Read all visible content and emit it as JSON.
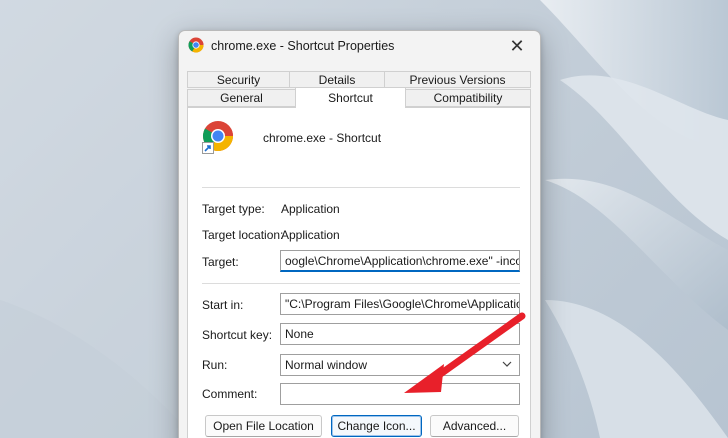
{
  "window": {
    "title": "chrome.exe - Shortcut Properties",
    "close_glyph": "✕"
  },
  "tabs": {
    "row1": [
      "Security",
      "Details",
      "Previous Versions"
    ],
    "row2": [
      "General",
      "Shortcut",
      "Compatibility"
    ],
    "active": "Shortcut"
  },
  "shortcut": {
    "name": "chrome.exe - Shortcut",
    "target_type_label": "Target type:",
    "target_type_value": "Application",
    "target_location_label": "Target location:",
    "target_location_value": "Application",
    "target_label": "Target:",
    "target_value": "oogle\\Chrome\\Application\\chrome.exe\" -incognito",
    "start_in_label": "Start in:",
    "start_in_value": "\"C:\\Program Files\\Google\\Chrome\\Application\"",
    "shortcut_key_label": "Shortcut key:",
    "shortcut_key_value": "None",
    "run_label": "Run:",
    "run_value": "Normal window",
    "comment_label": "Comment:",
    "comment_value": ""
  },
  "buttons": {
    "open_file_location": "Open File Location",
    "change_icon": "Change Icon...",
    "advanced": "Advanced..."
  },
  "icons": {
    "app_icon": "chrome-icon",
    "shortcut_overlay": "shortcut-arrow-icon",
    "dropdown": "chevron-down-icon",
    "annotation": "red-arrow-pointer"
  },
  "colors": {
    "accent": "#0067c0",
    "annotation_red": "#e8202a",
    "chrome_red": "#db4437",
    "chrome_yellow": "#f4b400",
    "chrome_green": "#0f9d58",
    "chrome_blue": "#4285f4"
  }
}
